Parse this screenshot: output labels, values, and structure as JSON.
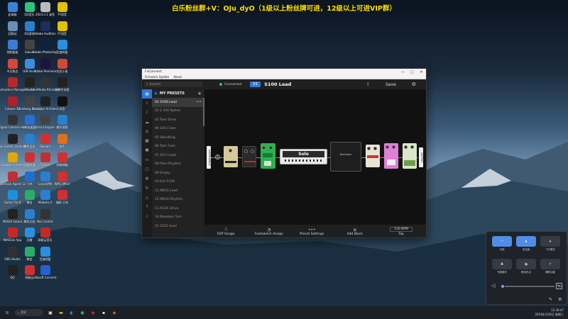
{
  "banner": "白乐粉丝群+V：OJu_dyO（1级以上粉丝牌可进，12级以上可进VIP群）",
  "desktop_icons": [
    {
      "label": "此电脑",
      "icon": "computer-icon",
      "color": "#3b82d6"
    },
    {
      "label": "回收站",
      "icon": "recycle-bin-icon",
      "color": "#6b8fb5"
    },
    {
      "label": "控制面板",
      "icon": "control-panel-icon",
      "color": "#3a7bd5"
    },
    {
      "label": "今日热点",
      "icon": "news-icon",
      "color": "#d24a3a"
    },
    {
      "label": "Activation Manager",
      "icon": "activation-icon",
      "color": "#b8282c"
    },
    {
      "label": "Cubase 13",
      "icon": "cubase-icon",
      "color": "#b01f2a"
    },
    {
      "label": "Elgato Camera Hub",
      "icon": "elgato-icon",
      "color": "#333"
    },
    {
      "label": "Epic Games Launcher",
      "icon": "epic-icon",
      "color": "#222"
    },
    {
      "label": "Google Chrome",
      "icon": "chrome-icon",
      "color": "#e0a800"
    },
    {
      "label": "Gimmick Agent 13",
      "icon": "agent-icon",
      "color": "#c03030"
    },
    {
      "label": "Guitar Pro 8",
      "icon": "guitarpro-icon",
      "color": "#1f8fe0"
    },
    {
      "label": "MAGIX Sound",
      "icon": "magix-icon",
      "color": "#222"
    },
    {
      "label": "NetEase App",
      "icon": "netease-icon",
      "color": "#c62828"
    },
    {
      "label": "OBS Studio",
      "icon": "obs-icon",
      "color": "#303030"
    },
    {
      "label": "QQ",
      "icon": "qq-icon",
      "color": "#222"
    },
    {
      "label": "QQ音乐",
      "icon": "qqmusic-icon",
      "color": "#31c27c"
    },
    {
      "label": "QQ游戏",
      "icon": "qqgame-icon",
      "color": "#2a7fd0"
    },
    {
      "label": "Sakuki",
      "icon": "sakuki-icon",
      "color": "#444"
    },
    {
      "label": "GiN Ver.2",
      "icon": "gin-icon",
      "color": "#3a8ee0"
    },
    {
      "label": "Waves",
      "icon": "waves-icon",
      "color": "#222"
    },
    {
      "label": "Steinberg Library",
      "icon": "steinberg-icon",
      "color": "#444"
    },
    {
      "label": "UU加速器",
      "icon": "uu-icon",
      "color": "#2a6fd0"
    },
    {
      "label": "腾讯会议",
      "icon": "meeting-icon",
      "color": "#2a7fd0"
    },
    {
      "label": "网易有道",
      "icon": "youdao-icon",
      "color": "#d03030"
    },
    {
      "label": "飞书",
      "icon": "feishu-icon",
      "color": "#1f6fd0"
    },
    {
      "label": "微信",
      "icon": "wechat-icon",
      "color": "#2aae67"
    },
    {
      "label": "腾讯文档",
      "icon": "docs-icon",
      "color": "#2a7fd0"
    },
    {
      "label": "迅雷",
      "icon": "xunlei-icon",
      "color": "#2a8fe0"
    },
    {
      "label": "微信",
      "icon": "wechat-icon",
      "color": "#2aae67"
    },
    {
      "label": "网易云",
      "icon": "cloudmusic-icon",
      "color": "#d03030"
    },
    {
      "label": "2023.3.1 录音",
      "icon": "recording-icon",
      "color": "#bbb"
    },
    {
      "label": "Adobe Audition",
      "icon": "audition-icon",
      "color": "#1b2f5a"
    },
    {
      "label": "Adobe Photoshop",
      "icon": "photoshop-icon",
      "color": "#0b2240"
    },
    {
      "label": "Adobe Premiere",
      "icon": "premiere-icon",
      "color": "#1f1440"
    },
    {
      "label": "AlterMedia RIControl",
      "icon": "altermedia-icon",
      "color": "#333"
    },
    {
      "label": "Blackstar Architect",
      "icon": "blackstar-icon",
      "color": "#222"
    },
    {
      "label": "Gmail Engine",
      "icon": "gmail-icon",
      "color": "#444"
    },
    {
      "label": "Gwuaro",
      "icon": "gwuaro-icon",
      "color": "#d03030"
    },
    {
      "label": "FxTools",
      "icon": "fxtools-icon",
      "color": "#c03030"
    },
    {
      "label": "LianaVPN",
      "icon": "vpn-icon",
      "color": "#2a7fd0"
    },
    {
      "label": "Mubutu 4",
      "icon": "mubutu-icon",
      "color": "#2a7fd0"
    },
    {
      "label": "Nio Control",
      "icon": "nio-icon",
      "color": "#333"
    },
    {
      "label": "网易云音乐",
      "icon": "music-icon",
      "color": "#c62828"
    },
    {
      "label": "百度网盘",
      "icon": "baidu-icon",
      "color": "#2a8fe0"
    },
    {
      "label": "Ubisoft Connect",
      "icon": "ubisoft-icon",
      "color": "#2a5fd0"
    },
    {
      "label": "YY语音",
      "icon": "yy-icon",
      "color": "#e0c000"
    },
    {
      "label": "YY语音",
      "icon": "yy-icon",
      "color": "#e0c000"
    },
    {
      "label": "百度网盘",
      "icon": "baidu-icon",
      "color": "#2a8fe0"
    },
    {
      "label": "拉拉小说",
      "icon": "novel-icon",
      "color": "#d04a3a"
    },
    {
      "label": "剪映专业版",
      "icon": "jianying-icon",
      "color": "#222"
    },
    {
      "label": "抖音",
      "icon": "douyin-icon",
      "color": "#111"
    },
    {
      "label": "腾讯视频",
      "icon": "tencentvideo-icon",
      "color": "#2a7fd0"
    },
    {
      "label": "快手",
      "icon": "kuaishou-icon",
      "color": "#e07020"
    },
    {
      "label": "网易邮箱",
      "icon": "mail-icon",
      "color": "#d03030"
    },
    {
      "label": "WPS Office",
      "icon": "wps-icon",
      "color": "#d03030"
    },
    {
      "label": "福昕 日本",
      "icon": "foxit-icon",
      "color": "#d03030"
    }
  ],
  "app": {
    "window_title": "FxConnect",
    "menu": [
      "Firmware Update",
      "About"
    ],
    "window_controls": [
      "—",
      "□",
      "✕"
    ],
    "search_placeholder": "Search",
    "connection_status": "Connected",
    "preset_number": "01",
    "preset_name": "S100 Lead",
    "save_label": "Save",
    "presets_header": "MY PRESETS",
    "presets": [
      "01 S100 Lead",
      "02 S 100 Rythm",
      "03 Twin Drive",
      "04 183 Clean",
      "05 VibraKing",
      "06 Twin Funk",
      "07 ACCI Lead",
      "08 Plexi Rhythm",
      "09 Empty",
      "10 Esh 5150",
      "11 MESA Lead",
      "12 MESA Rhythm",
      "13 ACDC Drive",
      "14 Massless Turn",
      "15 2333 level"
    ],
    "selected_preset_index": 0,
    "chain": {
      "input_label": "INSTRUMENT",
      "output_label": "OUTPUT",
      "amp_label": "Solo",
      "cab_label": "Blackstar",
      "pedals_before": [
        {
          "name": "drive-pedal",
          "color": "#d8c99a"
        },
        {
          "name": "fuzz-pedal",
          "color": "#2a2a2a"
        },
        {
          "name": "od-pedal",
          "color": "#2bb24c"
        }
      ],
      "pedals_after": [
        {
          "name": "chorus-pedal",
          "color": "#e8e3d3"
        },
        {
          "name": "flanger-pedal",
          "color": "#e07fd8"
        },
        {
          "name": "delay-pedal",
          "color": "#d9e6c9"
        }
      ]
    },
    "bottom_actions": [
      {
        "label": "EXP Assign",
        "icon": "exp-pedal-icon",
        "glyph": "⎍"
      },
      {
        "label": "Footswitch Assign",
        "icon": "footswitch-icon",
        "glyph": "◔"
      },
      {
        "label": "Preset Settings",
        "icon": "more-icon",
        "glyph": "•••"
      },
      {
        "label": "Add Block",
        "icon": "add-icon",
        "glyph": "⊕"
      }
    ],
    "bpm": "120 BPM",
    "tap_label": "Tap"
  },
  "quick_settings": {
    "buttons": [
      {
        "label": "可用",
        "glyph": "◠",
        "on": true
      },
      {
        "label": "未连接",
        "glyph": "ʙ",
        "on": true
      },
      {
        "label": "飞行模式",
        "glyph": "✈",
        "on": false
      },
      {
        "label": "节能模式",
        "glyph": "♣",
        "on": false
      },
      {
        "label": "移动热点",
        "glyph": "◉",
        "on": false
      },
      {
        "label": "辅助功能",
        "glyph": "☥",
        "on": false
      }
    ],
    "volume_level": 0.02
  },
  "taskbar": {
    "search_placeholder": "搜索",
    "time": "12:30:47",
    "date": "2024年3月6日 星期三"
  }
}
